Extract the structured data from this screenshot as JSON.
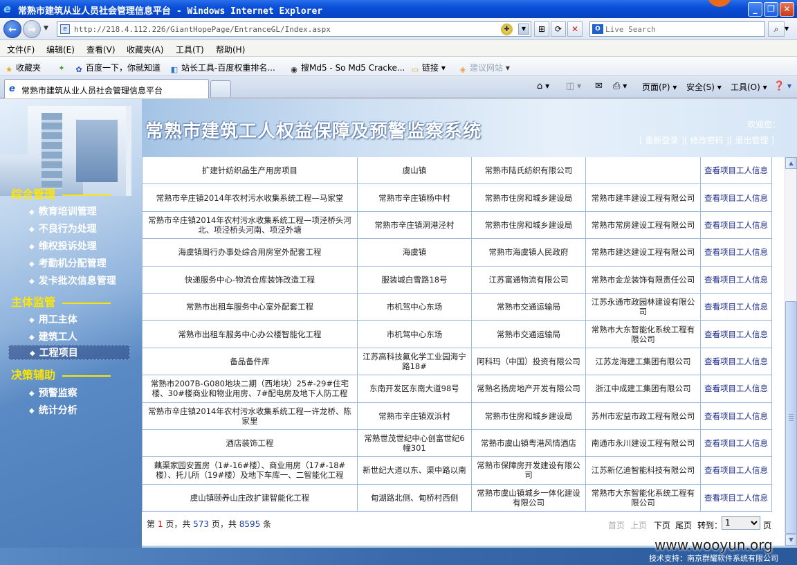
{
  "window": {
    "title": "常熟市建筑从业人员社会管理信息平台 - Windows Internet Explorer",
    "minimize": "_",
    "restore": "❐",
    "close": "✕"
  },
  "address": {
    "url": "http://218.4.112.226/GiantHopePage/EntranceGL/Index.aspx",
    "search_placeholder": "Live Search"
  },
  "menu": [
    "文件(F)",
    "编辑(E)",
    "查看(V)",
    "收藏夹(A)",
    "工具(T)",
    "帮助(H)"
  ],
  "favorites": {
    "label": "收藏夹",
    "items": [
      "百度一下，你就知道",
      "站长工具-百度权重排名...",
      "搜Md5 - So Md5 Cracke...",
      "链接",
      "建议网站"
    ]
  },
  "tab": {
    "label": "常熟市建筑从业人员社会管理信息平台"
  },
  "commands": {
    "page": "页面(P)",
    "safety": "安全(S)",
    "tools": "工具(O)"
  },
  "header": {
    "site_title": "常熟市建筑工人权益保障及预警监察系统",
    "welcome": "欢迎您：",
    "relogin": "重新登录",
    "change_password": "修改密码",
    "logout": "退出管理"
  },
  "sidebar": {
    "sections": [
      {
        "title": "综合管理",
        "items": [
          "教育培训管理",
          "不良行为处理",
          "维权投诉处理",
          "考勤机分配管理",
          "发卡批次信息管理"
        ]
      },
      {
        "title": "主体监管",
        "items": [
          "用工主体",
          "建筑工人",
          "工程项目"
        ]
      },
      {
        "title": "决策辅助",
        "items": [
          "预警监察",
          "统计分析"
        ]
      }
    ],
    "active_item": "工程项目"
  },
  "table": {
    "rows": [
      [
        "扩建针纺织品生产用房项目",
        "虞山镇",
        "常熟市陆氏纺织有限公司",
        "",
        "查看项目工人信息"
      ],
      [
        "常熟市辛庄镇2014年农村污水收集系统工程—马家堂",
        "常熟市辛庄镇杨中村",
        "常熟市住房和城乡建设局",
        "常熟市建丰建设工程有限公司",
        "查看项目工人信息"
      ],
      [
        "常熟市辛庄镇2014年农村污水收集系统工程—项泾桥头河北、项泾桥头河南、项泾外塘",
        "常熟市辛庄镇洞港泾村",
        "常熟市住房和城乡建设局",
        "常熟市常房建设工程有限公司",
        "查看项目工人信息"
      ],
      [
        "海虞镇周行办事处综合用房室外配套工程",
        "海虞镇",
        "常熟市海虞镇人民政府",
        "常熟市建达建设工程有限公司",
        "查看项目工人信息"
      ],
      [
        "快递服务中心-物流仓库装饰改造工程",
        "服装城白雪路18号",
        "江苏富通物流有限公司",
        "常熟市金龙装饰有限责任公司",
        "查看项目工人信息"
      ],
      [
        "常熟市出租车服务中心室外配套工程",
        "市机驾中心东场",
        "常熟市交通运输局",
        "江苏永通市政园林建设有限公司",
        "查看项目工人信息"
      ],
      [
        "常熟市出租车服务中心办公楼智能化工程",
        "市机驾中心东场",
        "常熟市交通运输局",
        "常熟市大东智能化系统工程有限公司",
        "查看项目工人信息"
      ],
      [
        "备品备件库",
        "江苏高科技氟化学工业园海宁路18#",
        "阿科玛（中国）投资有限公司",
        "江苏龙海建工集团有限公司",
        "查看项目工人信息"
      ],
      [
        "常熟市2007B-G080地块二期（西地块）25#-29#住宅楼、30#楼商业和物业用房、7#配电房及地下人防工程",
        "东南开发区东南大道98号",
        "常熟名扬房地产开发有限公司",
        "浙江中成建工集团有限公司",
        "查看项目工人信息"
      ],
      [
        "常熟市辛庄镇2014年农村污水收集系统工程—许龙桥、陈家里",
        "常熟市辛庄镇双浜村",
        "常熟市住房和城乡建设局",
        "苏州市宏益市政工程有限公司",
        "查看项目工人信息"
      ],
      [
        "酒店装饰工程",
        "常熟世茂世纪中心创富世纪6幢301",
        "常熟市虞山镇粤港风情酒店",
        "南通市永川建设工程有限公司",
        "查看项目工人信息"
      ],
      [
        "藕渠家园安置房（1#-16#楼）、商业用房（17#-18#楼）、托儿所（19#楼）及地下车库一、二智能化工程",
        "新世纪大道以东、渠中路以南",
        "常熟市保障房开发建设有限公司",
        "江苏新亿迪智能科技有限公司",
        "查看项目工人信息"
      ],
      [
        "虞山镇颐养山庄改扩建智能化工程",
        "甸湖路北侧、甸桥村西侧",
        "常熟市虞山镇城乡一体化建设有限公司",
        "常熟市大东智能化系统工程有限公司",
        "查看项目工人信息"
      ]
    ]
  },
  "pager": {
    "prefix": "第",
    "page": "1",
    "mid1": "页，共",
    "total_pages": "573",
    "mid2": "页，共",
    "total_records": "8595",
    "suffix": "条",
    "first": "首页",
    "prev": "上页",
    "next": "下页",
    "last": "尾页",
    "goto": "转到：",
    "selected": "1",
    "page_unit": "页"
  },
  "footer": {
    "tech_support": "技术支持：南京群耀软件系统有限公司"
  },
  "watermark": "www.wooyun.org",
  "colors": {
    "title_bar": "#0a4fd8",
    "nav_section": "#ffe600",
    "page_red": "#d00000",
    "page_blue": "#1a3aa0",
    "grid_border": "#9db9d9"
  }
}
